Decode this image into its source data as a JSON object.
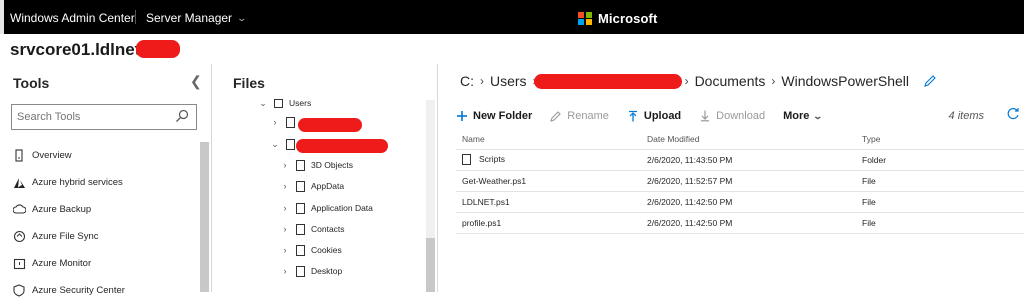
{
  "topbar": {
    "app_title": "Windows Admin Center",
    "server_manager": "Server Manager",
    "brand": "Microsoft",
    "brand_colors": [
      "#f25022",
      "#7fba00",
      "#00a4ef",
      "#ffb900"
    ]
  },
  "server": {
    "name": "srvcore01.ldlnet"
  },
  "tools": {
    "title": "Tools",
    "search_placeholder": "Search Tools",
    "items": [
      {
        "label": "Overview",
        "icon": "server-icon"
      },
      {
        "label": "Azure hybrid services",
        "icon": "azure-icon"
      },
      {
        "label": "Azure Backup",
        "icon": "backup-icon"
      },
      {
        "label": "Azure File Sync",
        "icon": "file-sync-icon"
      },
      {
        "label": "Azure Monitor",
        "icon": "monitor-icon"
      },
      {
        "label": "Azure Security Center",
        "icon": "shield-icon"
      }
    ]
  },
  "files": {
    "title": "Files",
    "tree": {
      "users": "Users",
      "children": [
        "3D Objects",
        "AppData",
        "Application Data",
        "Contacts",
        "Cookies",
        "Desktop"
      ]
    }
  },
  "content": {
    "breadcrumb": [
      "C:",
      "Users",
      "Documents",
      "WindowsPowerShell"
    ],
    "toolbar": {
      "new_folder": "New Folder",
      "rename": "Rename",
      "upload": "Upload",
      "download": "Download",
      "more": "More"
    },
    "items_count": "4 items",
    "columns": {
      "name": "Name",
      "date": "Date Modified",
      "type": "Type"
    },
    "rows": [
      {
        "name": "Scripts",
        "date": "2/6/2020, 11:43:50 PM",
        "type": "Folder"
      },
      {
        "name": "Get-Weather.ps1",
        "date": "2/6/2020, 11:52:57 PM",
        "type": "File"
      },
      {
        "name": "LDLNET.ps1",
        "date": "2/6/2020, 11:42:50 PM",
        "type": "File"
      },
      {
        "name": "profile.ps1",
        "date": "2/6/2020, 11:42:50 PM",
        "type": "File"
      }
    ]
  },
  "accent_color": "#0078d4",
  "redaction_color": "#ef1b1b"
}
